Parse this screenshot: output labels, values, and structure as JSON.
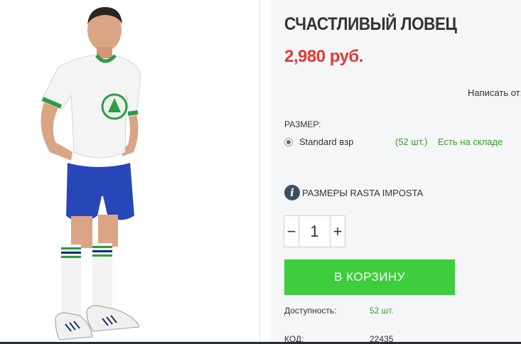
{
  "product": {
    "title": "СЧАСТЛИВЫЙ ЛОВЕЦ",
    "price": "2,980 руб.",
    "write_link": "Написать от:",
    "size_label": "РАЗМЕР:",
    "size_option": {
      "name": "Standard взр",
      "qty": "(52 шт.)",
      "stock": "Есть на складе",
      "selected": true
    },
    "sizes_link": "РАЗМЕРЫ RASTA IMPOSTA",
    "quantity": {
      "minus": "−",
      "value": "1",
      "plus": "+"
    },
    "cart_button": "В КОРЗИНУ",
    "availability_label": "Доступность:",
    "availability_value": "52 шт.",
    "code_label": "КОД:",
    "code_value": "22435"
  },
  "icons": {
    "info": "i"
  },
  "colors": {
    "price": "#e53935",
    "accent_green": "#3dcd3d",
    "stock_green": "#3a9b2a",
    "panel_bg": "#f5f6f8"
  }
}
